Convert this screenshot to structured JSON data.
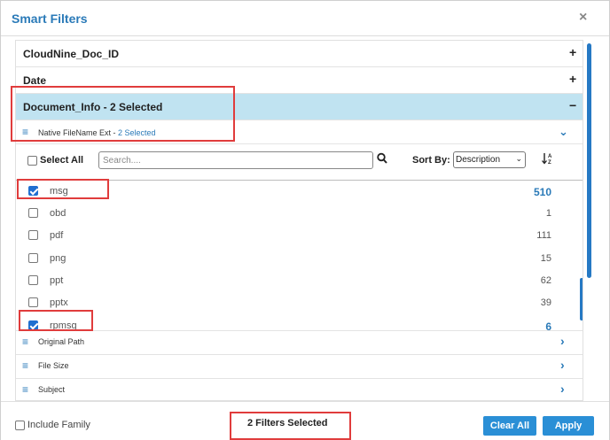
{
  "dialog": {
    "title": "Smart Filters",
    "close_glyph": "×"
  },
  "sections": [
    {
      "label": "CloudNine_Doc_ID",
      "sign": "+"
    },
    {
      "label": "Date",
      "sign": "+"
    },
    {
      "label": "Document_Info - 2 Selected",
      "sign": "−"
    }
  ],
  "active_filter": {
    "label": "Native FileName Ext",
    "separator": " - ",
    "selected": "2 Selected"
  },
  "toolbar": {
    "select_all_label": "Select All",
    "search_placeholder": "Search....",
    "sort_label": "Sort By:",
    "sort_value": "Description",
    "sort_caret": "⌄",
    "sort_icon_up": "↓",
    "sort_icon_text": "Z",
    "sort_icon_text2": "A"
  },
  "items": [
    {
      "name": "msg",
      "count": "510",
      "checked": true
    },
    {
      "name": "obd",
      "count": "1",
      "checked": false
    },
    {
      "name": "pdf",
      "count": "111",
      "checked": false
    },
    {
      "name": "png",
      "count": "15",
      "checked": false
    },
    {
      "name": "ppt",
      "count": "62",
      "checked": false
    },
    {
      "name": "pptx",
      "count": "39",
      "checked": false
    },
    {
      "name": "rpmsg",
      "count": "6",
      "checked": true
    }
  ],
  "other_filters": [
    {
      "label": "Original Path"
    },
    {
      "label": "File Size"
    },
    {
      "label": "Subject"
    }
  ],
  "footer": {
    "include_family_label": "Include Family",
    "filters_selected": "2 Filters Selected",
    "clear_all_label": "Clear All",
    "apply_label": "Apply"
  },
  "colors": {
    "accent": "#2a7ab8",
    "button": "#2a8fd6",
    "active_section": "#c0e3f1",
    "highlight_box": "#e03c3c",
    "checkbox": "#1f6fd0"
  },
  "icons": {
    "menu": "hamburger-icon",
    "expand": "chevron-down-icon",
    "collapsed": "chevron-right-icon",
    "search": "search-icon",
    "sort": "sort-icon",
    "close": "close-icon"
  }
}
